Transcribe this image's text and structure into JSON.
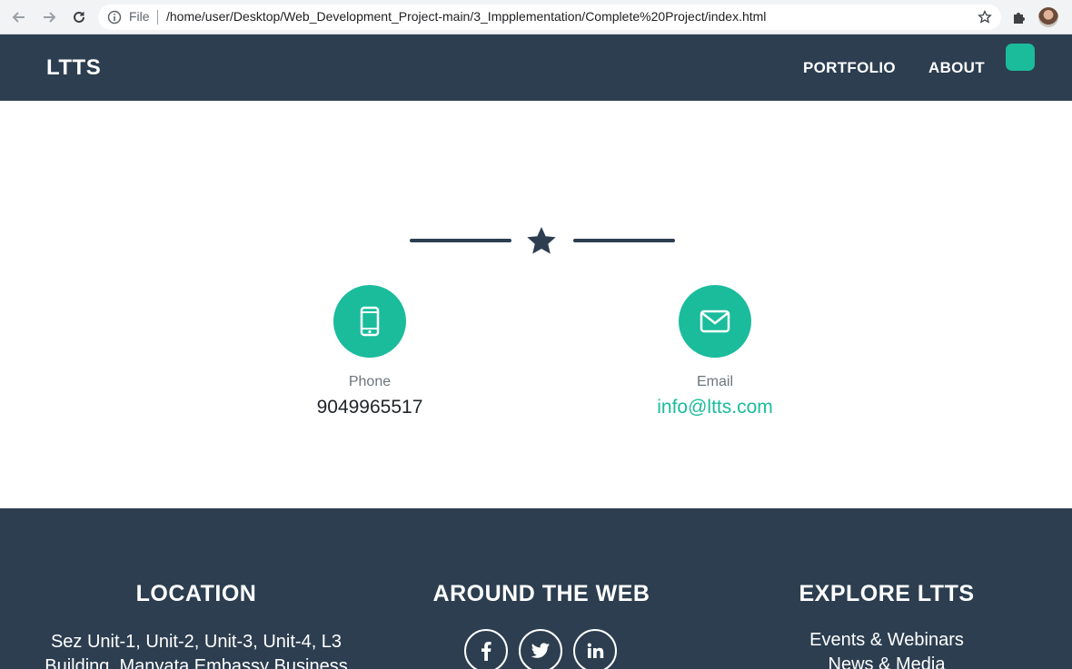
{
  "browser": {
    "file_label": "File",
    "url": "/home/user/Desktop/Web_Development_Project-main/3_Impplementation/Complete%20Project/index.html"
  },
  "navbar": {
    "brand": "LTTS",
    "links": [
      "PORTFOLIO",
      "ABOUT"
    ]
  },
  "contact": {
    "phone_label": "Phone",
    "phone_value": "9049965517",
    "email_label": "Email",
    "email_value": "info@ltts.com"
  },
  "footer": {
    "location_title": "LOCATION",
    "location_text": [
      "Sez Unit-1, Unit-2, Unit-3, Unit-4, L3",
      "Building, Manyata Embassy Business"
    ],
    "web_title": "AROUND THE WEB",
    "social": [
      {
        "icon": "facebook-icon",
        "glyph": "f"
      },
      {
        "icon": "twitter-icon",
        "glyph": "t"
      },
      {
        "icon": "linkedin-icon",
        "glyph": "in"
      }
    ],
    "explore_title": "EXPLORE LTTS",
    "explore_links": [
      "Events & Webinars",
      "News & Media"
    ]
  },
  "colors": {
    "primary": "#2c3e50",
    "accent": "#1abc9c"
  }
}
